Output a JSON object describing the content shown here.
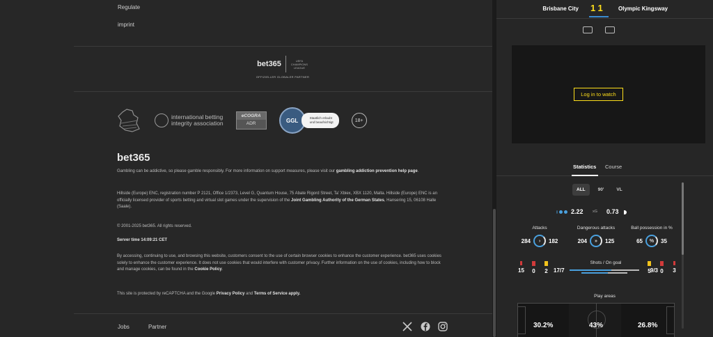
{
  "footer": {
    "links_top": [
      "Regulate",
      "imprint"
    ],
    "partner": {
      "brand": "bet365",
      "ucl": "UEFA CHAMPIONS LEAGUE",
      "subtitle": "OFFIZIELLER GLOBALER PARTNER"
    },
    "badges": {
      "ibia_line1": "international betting",
      "ibia_line2": "integrity association",
      "ecogra_top": "eCOGRA",
      "ecogra_bottom": "ADR",
      "ggl_seal": "GGL",
      "ggl_line1": "Staatlich erlaubt",
      "ggl_line2": "und beaufsichtigt",
      "age": "18+"
    },
    "brand": "bet365",
    "para1_a": "Gambling can be addictive, so please gamble responsibly. For more information on support measures, please visit our ",
    "para1_link": "gambling addiction prevention help page",
    "para1_b": ".",
    "para2_a": "Hillside (Europe) ENC, registration number P 2121, Office 1/2373, Level G, Quantum House, 75 Abate Rigord Street, Ta' Xbiex, XBX 1120, Malta.",
    "para2_b": "Hillside (Europe) ENC is an officially licensed provider of sports betting and virtual slot games under the supervision of the ",
    "para2_link": "Joint Gambling Authority of the German States",
    "para2_c": ", Hansering 15, 06108 Halle (Saale).",
    "copyright": "© 2001-2025 bet365. All rights reserved.",
    "server_time": "Server time 14:09:21 CET",
    "cookies_a": "By accessing, continuing to use, and browsing this website, customers consent to the use of certain browser cookies to enhance the customer experience. bet365 uses cookies solely to enhance the customer experience. It does not use cookies that would interfere with customer privacy. Further information on the use of cookies, including how to block and manage cookies, can be found in the ",
    "cookies_link": "Cookie Policy",
    "cookies_b": ".",
    "recaptcha_a": "This site is protected by reCAPTCHA and the Google ",
    "recaptcha_privacy": "Privacy Policy",
    "recaptcha_and": " and ",
    "recaptcha_terms": "Terms of Service apply.",
    "bottom_links": [
      "Jobs",
      "Partner"
    ],
    "social_icons": [
      "x-icon",
      "facebook-icon",
      "instagram-icon"
    ]
  },
  "match": {
    "home": "Brisbane City",
    "score_home": "1",
    "score_away": "1",
    "away": "Olympic Kingsway",
    "login_label": "Log in to watch",
    "tabs": [
      "Statistics",
      "Course"
    ],
    "filters": [
      "ALL",
      "90'",
      "VL"
    ],
    "xg_home": "2.22",
    "xg_label": "xG",
    "xg_away": "0.73",
    "attacks_title": "Attacks",
    "attacks_home": "284",
    "attacks_away": "182",
    "dangerous_title": "Dangerous attacks",
    "dangerous_home": "204",
    "dangerous_away": "125",
    "possession_title": "Ball possession in %",
    "possession_home": "65",
    "possession_away": "35",
    "shots_title": "Shots / On goal",
    "shots_home": "17/7",
    "shots_away": "9/3",
    "cards_home": [
      "15",
      "0",
      "2"
    ],
    "cards_away": [
      "5",
      "0",
      "3"
    ],
    "play_areas_title": "Play areas",
    "play_left": "30.2%",
    "play_mid": "43%",
    "play_right": "26.8%"
  },
  "colors": {
    "accent_yellow": "#ffdf1b",
    "home_blue": "#4aa0de",
    "card_red": "#d23a3a",
    "card_yellow": "#f2c31c"
  }
}
